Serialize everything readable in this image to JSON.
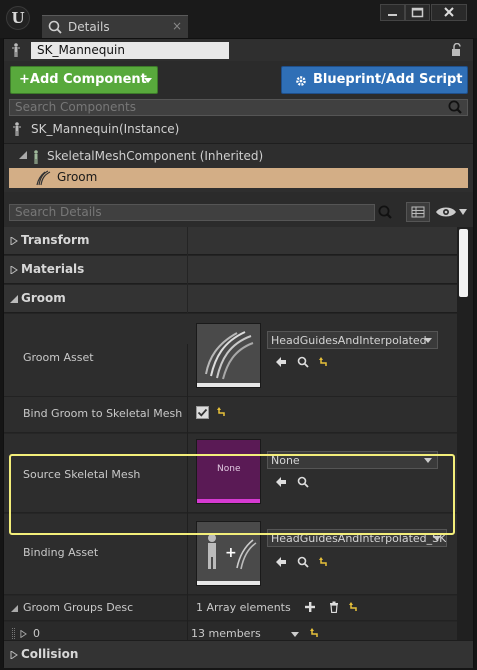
{
  "window": {
    "tab_title": "Details",
    "tab_close": "×",
    "logo_letter": "U"
  },
  "actor": {
    "name": "SK_Mannequin"
  },
  "toolbar": {
    "add_component": "Add Component",
    "add_component_prefix": "+",
    "blueprint_script": "Blueprint/Add Script"
  },
  "components": {
    "search_placeholder": "Search Components",
    "instance_label": "SK_Mannequin(Instance)",
    "tree": [
      {
        "label": "SkeletalMeshComponent (Inherited)"
      },
      {
        "label": "Groom"
      }
    ]
  },
  "details": {
    "search_placeholder": "Search Details",
    "categories": {
      "transform": "Transform",
      "materials": "Materials",
      "groom": "Groom",
      "collision": "Collision"
    },
    "groom_asset": {
      "label": "Groom Asset",
      "value": "HeadGuidesAndInterpolated"
    },
    "bind_groom": {
      "label": "Bind Groom to Skeletal Mesh",
      "checked": true
    },
    "source_skeletal_mesh": {
      "label": "Source Skeletal Mesh",
      "value": "None",
      "thumb_text": "None"
    },
    "binding_asset": {
      "label": "Binding Asset",
      "value": "HeadGuidesAndInterpolated_SK_I"
    },
    "groom_groups_desc": {
      "label": "Groom Groups Desc",
      "value": "1 Array elements"
    },
    "element_0": {
      "label": "0",
      "value": "13 members"
    }
  },
  "colors": {
    "add_button": "#58a93c",
    "blueprint_button": "#2f6fb6",
    "selection": "#d3ae86",
    "highlight": "#f3ee7a",
    "none_thumb": "#5a1a55",
    "reset_arrow": "#e8c23a"
  }
}
